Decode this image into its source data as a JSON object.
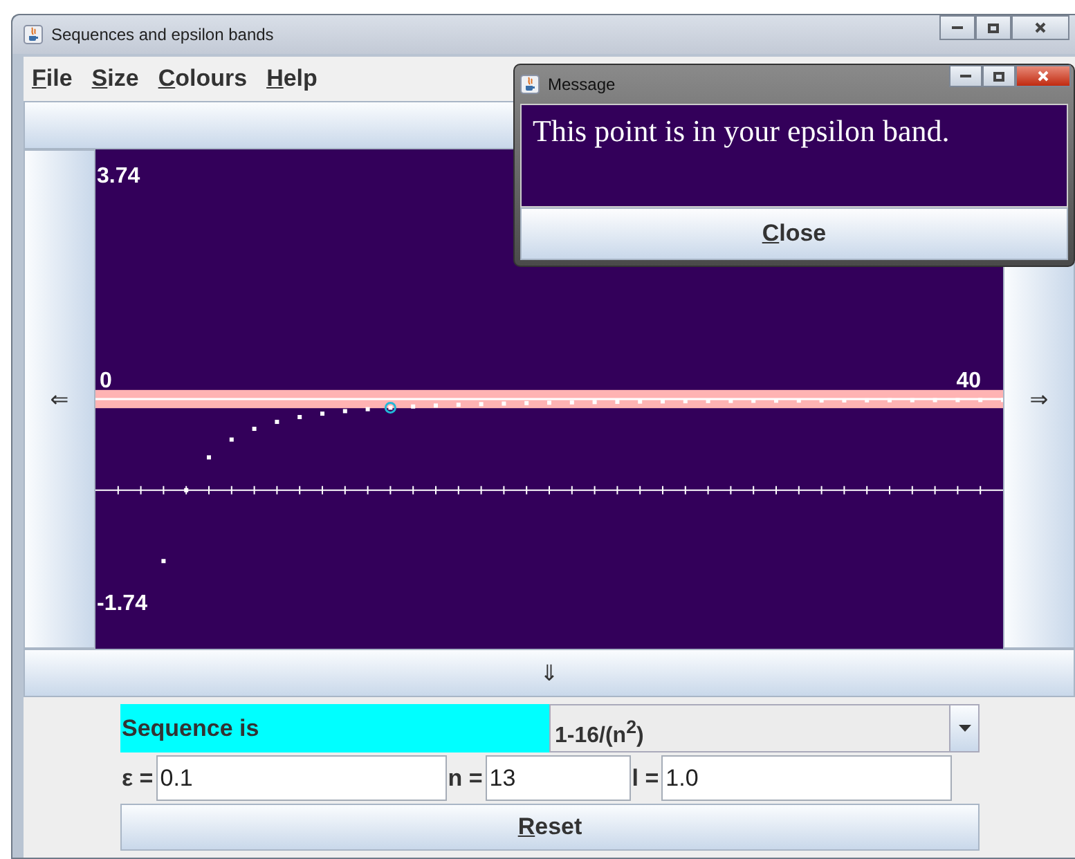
{
  "window": {
    "title": "Sequences and epsilon bands"
  },
  "menu": [
    {
      "label": "File"
    },
    {
      "label": "Size"
    },
    {
      "label": "Colours"
    },
    {
      "label": "Help"
    }
  ],
  "nav_buttons": {
    "left": "⇐",
    "right": "⇒",
    "down": "⇓"
  },
  "plot": {
    "range_labels": {
      "y_max": "3.74",
      "y_min": "-1.74",
      "x_min": "0",
      "x_max": "40"
    }
  },
  "sequence": {
    "label": "Sequence is",
    "value": "1-16/(n$^{2}$)"
  },
  "fields": [
    {
      "label": "ε =",
      "value": "0.1"
    },
    {
      "label": "n =",
      "value": "13"
    },
    {
      "label": "l =",
      "value": "1.0"
    }
  ],
  "reset_button": "Reset",
  "dialog": {
    "title": "Message",
    "message": "This point is in your epsilon band.",
    "button": "Close"
  }
}
